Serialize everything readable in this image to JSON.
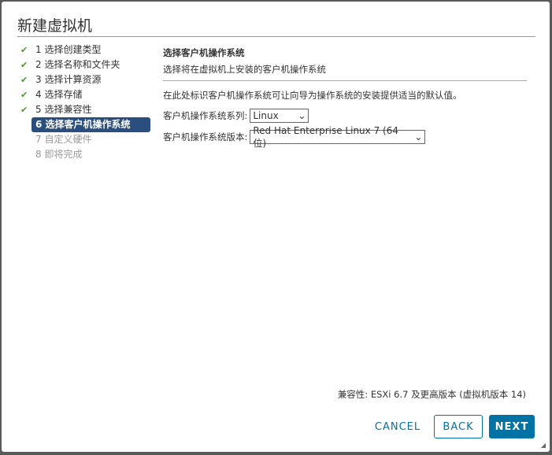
{
  "title": "新建虚拟机",
  "steps": [
    {
      "label": "1 选择创建类型",
      "state": "done"
    },
    {
      "label": "2 选择名称和文件夹",
      "state": "done"
    },
    {
      "label": "3 选择计算资源",
      "state": "done"
    },
    {
      "label": "4 选择存储",
      "state": "done"
    },
    {
      "label": "5 选择兼容性",
      "state": "done"
    },
    {
      "label": "6 选择客户机操作系统",
      "state": "active"
    },
    {
      "label": "7 自定义硬件",
      "state": "future"
    },
    {
      "label": "8 即将完成",
      "state": "future"
    }
  ],
  "main": {
    "heading": "选择客户机操作系统",
    "subheading": "选择将在虚拟机上安装的客户机操作系统",
    "description": "在此处标识客户机操作系统可让向导为操作系统的安装提供适当的默认值。",
    "family_label": "客户机操作系统系列:",
    "family_value": "Linux",
    "version_label": "客户机操作系统版本:",
    "version_value": "Red Hat Enterprise Linux 7 (64 位)"
  },
  "compat": "兼容性: ESXi 6.7 及更高版本 (虚拟机版本 14)",
  "buttons": {
    "cancel": "CANCEL",
    "back": "BACK",
    "next": "NEXT"
  },
  "check": "✔"
}
